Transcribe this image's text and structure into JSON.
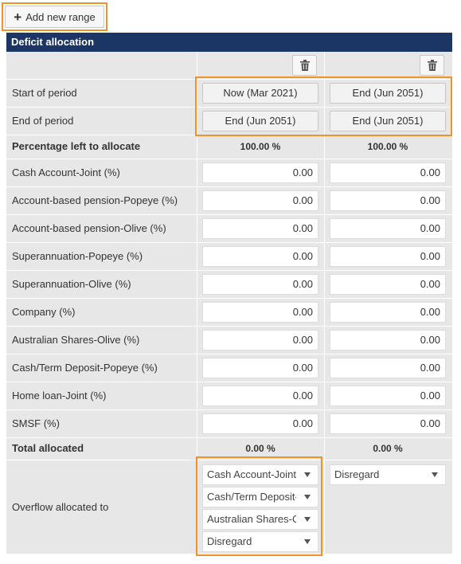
{
  "toolbar": {
    "add_range_label": "Add new range"
  },
  "panel": {
    "title": "Deficit allocation"
  },
  "period_rows": [
    {
      "label": "Start of period",
      "col1": "Now (Mar 2021)",
      "col2": "End (Jun 2051)"
    },
    {
      "label": "End of period",
      "col1": "End (Jun 2051)",
      "col2": "End (Jun 2051)"
    }
  ],
  "percentage_left": {
    "label": "Percentage left to allocate",
    "col1": "100.00 %",
    "col2": "100.00 %"
  },
  "allocation_rows": [
    {
      "label": "Cash Account-Joint (%)",
      "col1": "0.00",
      "col2": "0.00"
    },
    {
      "label": "Account-based pension-Popeye (%)",
      "col1": "0.00",
      "col2": "0.00"
    },
    {
      "label": "Account-based pension-Olive (%)",
      "col1": "0.00",
      "col2": "0.00"
    },
    {
      "label": "Superannuation-Popeye (%)",
      "col1": "0.00",
      "col2": "0.00"
    },
    {
      "label": "Superannuation-Olive (%)",
      "col1": "0.00",
      "col2": "0.00"
    },
    {
      "label": "Company (%)",
      "col1": "0.00",
      "col2": "0.00"
    },
    {
      "label": "Australian Shares-Olive (%)",
      "col1": "0.00",
      "col2": "0.00"
    },
    {
      "label": "Cash/Term Deposit-Popeye (%)",
      "col1": "0.00",
      "col2": "0.00"
    },
    {
      "label": "Home loan-Joint (%)",
      "col1": "0.00",
      "col2": "0.00"
    },
    {
      "label": "SMSF (%)",
      "col1": "0.00",
      "col2": "0.00"
    }
  ],
  "total_allocated": {
    "label": "Total allocated",
    "col1": "0.00 %",
    "col2": "0.00 %"
  },
  "overflow": {
    "label": "Overflow allocated to",
    "col1": [
      "Cash Account-Joint",
      "Cash/Term Deposit-I",
      "Australian Shares-Ol",
      "Disregard"
    ],
    "col2": [
      "Disregard"
    ]
  },
  "colors": {
    "header_bg": "#1b3664",
    "highlight": "#f0922a",
    "panel_bg": "#e7e7e7"
  },
  "icons": {
    "add": "plus-icon",
    "delete": "trash-icon",
    "dropdown": "chevron-down-icon"
  }
}
